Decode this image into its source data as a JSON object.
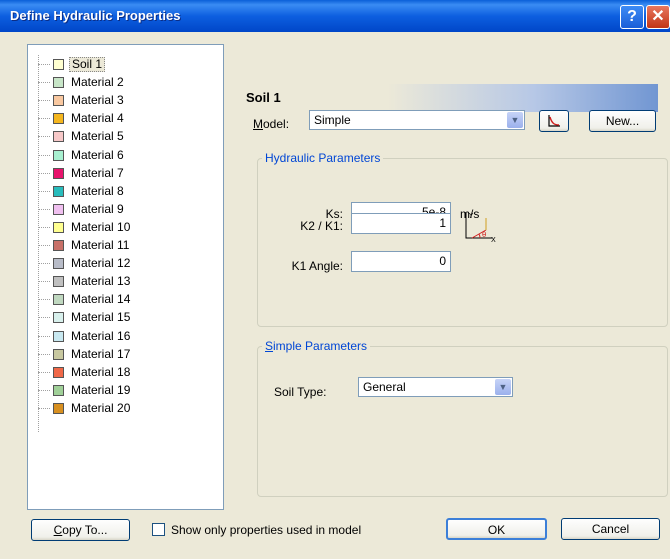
{
  "window": {
    "title": "Define Hydraulic Properties",
    "help_glyph": "?",
    "close_glyph": "✕"
  },
  "tree": {
    "items": [
      {
        "label": "Soil 1",
        "color": "#ffffd0"
      },
      {
        "label": "Material 2",
        "color": "#c8e6c8"
      },
      {
        "label": "Material 3",
        "color": "#f9c8a0"
      },
      {
        "label": "Material 4",
        "color": "#f5b61e"
      },
      {
        "label": "Material 5",
        "color": "#f7c8c8"
      },
      {
        "label": "Material 6",
        "color": "#a8f0d0"
      },
      {
        "label": "Material 7",
        "color": "#e8136c"
      },
      {
        "label": "Material 8",
        "color": "#28bcbc"
      },
      {
        "label": "Material 9",
        "color": "#f0c0f0"
      },
      {
        "label": "Material 10",
        "color": "#ffff90"
      },
      {
        "label": "Material 11",
        "color": "#c87068"
      },
      {
        "label": "Material 12",
        "color": "#b8bcc8"
      },
      {
        "label": "Material 13",
        "color": "#c0c0c0"
      },
      {
        "label": "Material 14",
        "color": "#c0d8c0"
      },
      {
        "label": "Material 15",
        "color": "#d8f0ec"
      },
      {
        "label": "Material 16",
        "color": "#c8e8f0"
      },
      {
        "label": "Material 17",
        "color": "#c8c8a0"
      },
      {
        "label": "Material 18",
        "color": "#f06848"
      },
      {
        "label": "Material 19",
        "color": "#a0d098"
      },
      {
        "label": "Material 20",
        "color": "#d89020"
      }
    ]
  },
  "panel": {
    "header": "Soil 1",
    "model_label": "Model:",
    "model_value": "Simple",
    "new_button": "New...",
    "hydraulic_title": "Hydraulic Parameters",
    "ks_label": "Ks:",
    "ks_value": "5e-8",
    "ks_unit": "m/s",
    "k2k1_label": "K2 / K1:",
    "k2k1_value": "1",
    "k1angle_label": "K1 Angle:",
    "k1angle_value": "0",
    "simple_title": "Simple Parameters",
    "soil_type_label": "Soil Type:",
    "soil_type_value": "General"
  },
  "footer": {
    "copy_button": "Copy To...",
    "show_only_label": "Show only properties used in model",
    "ok_button": "OK",
    "cancel_button": "Cancel"
  }
}
